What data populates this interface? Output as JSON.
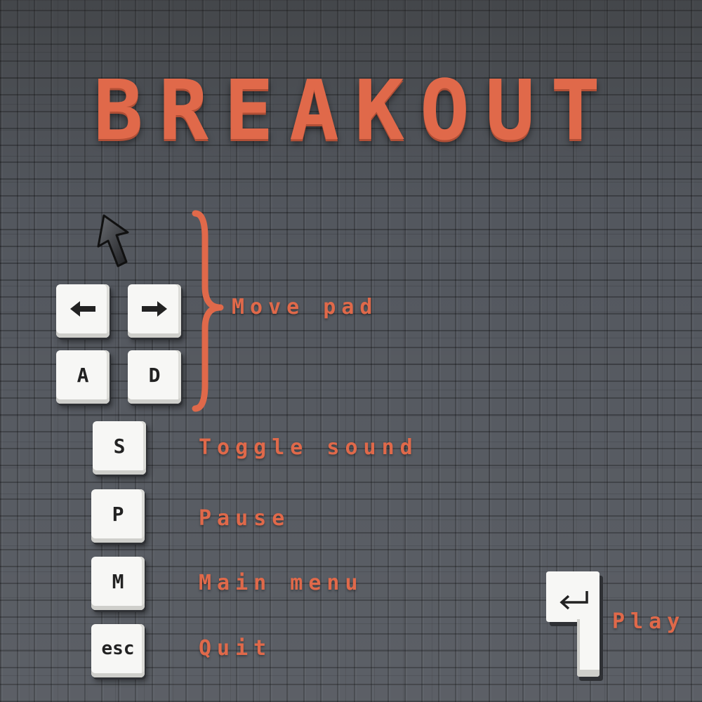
{
  "title": "BREAKOUT",
  "controls": {
    "move": {
      "keys": [
        "←",
        "→",
        "A",
        "D"
      ],
      "label": "Move pad",
      "icons": [
        "arrow-left-icon",
        "arrow-right-icon"
      ]
    },
    "sound": {
      "key": "S",
      "label": "Toggle sound"
    },
    "pause": {
      "key": "P",
      "label": "Pause"
    },
    "menu": {
      "key": "M",
      "label": "Main menu"
    },
    "quit": {
      "key": "esc",
      "label": "Quit"
    },
    "play": {
      "key_icon": "enter-return-icon",
      "label": "Play"
    }
  },
  "colors": {
    "accent": "#e0694a",
    "key_face": "#f7f7f5",
    "background": "#53575e"
  },
  "cursor_icon": "mouse-pointer-icon"
}
